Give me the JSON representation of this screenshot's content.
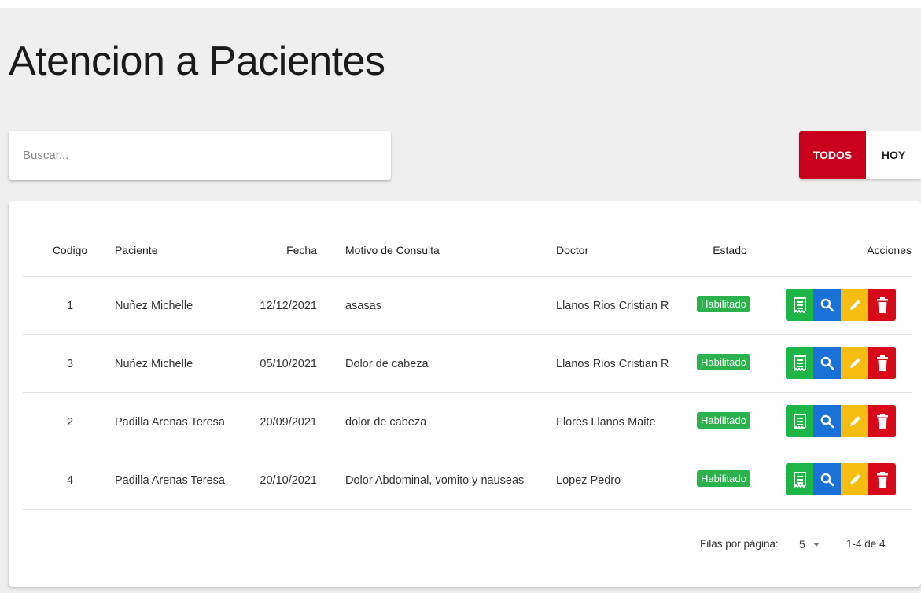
{
  "page": {
    "title": "Atencion a Pacientes"
  },
  "search": {
    "placeholder": "Buscar...",
    "value": ""
  },
  "filters": [
    {
      "label": "TODOS",
      "active": true
    },
    {
      "label": "HOY",
      "active": false
    }
  ],
  "table": {
    "headers": {
      "codigo": "Codigo",
      "paciente": "Paciente",
      "fecha": "Fecha",
      "motivo": "Motivo de Consulta",
      "doctor": "Doctor",
      "estado": "Estado",
      "acciones": "Acciones"
    },
    "rows": [
      {
        "codigo": "1",
        "paciente": "Nuñez Michelle",
        "fecha": "12/12/2021",
        "motivo": "asasas",
        "doctor": "Llanos Rios Cristian R",
        "estado": "Habilitado"
      },
      {
        "codigo": "3",
        "paciente": "Nuñez Michelle",
        "fecha": "05/10/2021",
        "motivo": "Dolor de cabeza",
        "doctor": "Llanos Rios Cristian R",
        "estado": "Habilitado"
      },
      {
        "codigo": "2",
        "paciente": "Padilla Arenas Teresa",
        "fecha": "20/09/2021",
        "motivo": "dolor de cabeza",
        "doctor": "Flores Llanos Maite",
        "estado": "Habilitado"
      },
      {
        "codigo": "4",
        "paciente": "Padilla Arenas Teresa",
        "fecha": "20/10/2021",
        "motivo": "Dolor Abdominal, vomito y nauseas",
        "doctor": "Lopez Pedro",
        "estado": "Habilitado"
      }
    ],
    "row_actions": [
      {
        "icon": "receipt-icon",
        "color": "#1eb547"
      },
      {
        "icon": "search-icon",
        "color": "#1a72d8"
      },
      {
        "icon": "pencil-icon",
        "color": "#f4bd0f"
      },
      {
        "icon": "trash-icon",
        "color": "#d60a18"
      }
    ]
  },
  "pagination": {
    "rows_per_page_label": "Filas por página:",
    "rows_per_page_value": "5",
    "range_label": "1-4 de 4"
  },
  "colors": {
    "accent": "#c8001e",
    "status_badge": "#2bb24c",
    "background": "#efefef"
  }
}
